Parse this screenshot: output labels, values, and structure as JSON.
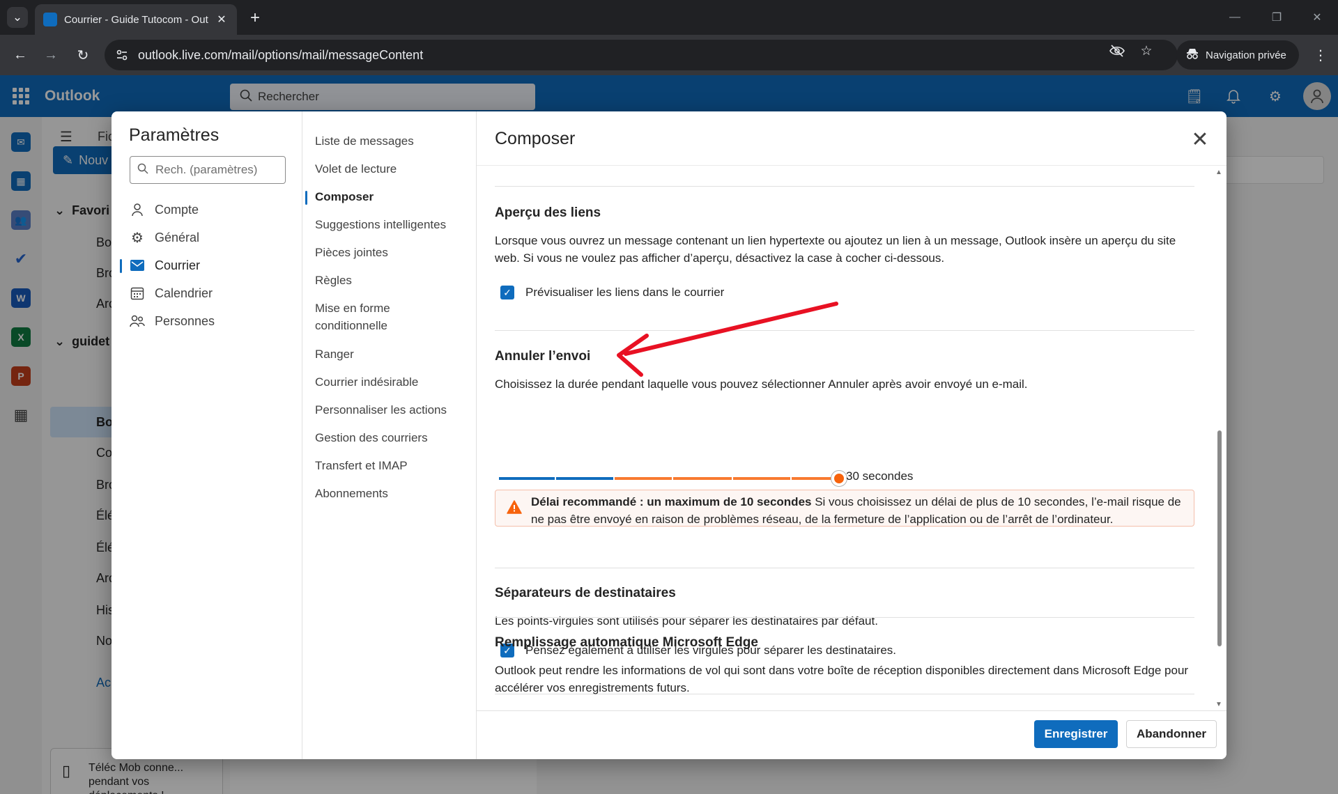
{
  "browser": {
    "tab_title": "Courrier - Guide Tutocom - Out",
    "url": "outlook.live.com/mail/options/mail/messageContent",
    "private_label": "Navigation privée"
  },
  "outlook": {
    "brand": "Outlook",
    "search_placeholder": "Rechercher",
    "new_mail_label": "Nouv",
    "folder_header_label": "Fic",
    "favorites_label": "Favori",
    "account_label": "guidet",
    "fav_items": [
      "Boi",
      "Bro",
      "Arc"
    ],
    "account_items": [
      "Boi",
      "Co",
      "Bro",
      "Élé",
      "Élé",
      "Arc",
      "His",
      "No"
    ],
    "groups_label": "Ac",
    "mobile_card_text": "Téléc Mob conne... pendant vos déplacements !"
  },
  "settings": {
    "title": "Paramètres",
    "search_placeholder": "Rech. (paramètres)",
    "categories": [
      {
        "label": "Compte",
        "icon": "person-icon"
      },
      {
        "label": "Général",
        "icon": "gear-icon"
      },
      {
        "label": "Courrier",
        "icon": "mail-icon",
        "active": true
      },
      {
        "label": "Calendrier",
        "icon": "calendar-icon"
      },
      {
        "label": "Personnes",
        "icon": "people-icon"
      }
    ],
    "subcategories": [
      "Liste de messages",
      "Volet de lecture",
      "Composer",
      "Suggestions intelligentes",
      "Pièces jointes",
      "Règles",
      "Mise en forme conditionnelle",
      "Ranger",
      "Courrier indésirable",
      "Personnaliser les actions",
      "Gestion des courriers",
      "Transfert et IMAP",
      "Abonnements"
    ],
    "active_subcategory": "Composer"
  },
  "pane": {
    "title": "Composer",
    "link_preview": {
      "heading": "Aperçu des liens",
      "description": "Lorsque vous ouvrez un message contenant un lien hypertexte ou ajoutez un lien à un message, Outlook insère un aperçu du site web. Si vous ne voulez pas afficher d’aperçu, désactivez la case à cocher ci-dessous.",
      "checkbox_label": "Prévisualiser les liens dans le courrier",
      "checked": true
    },
    "undo_send": {
      "heading": "Annuler l’envoi",
      "description": "Choisissez la durée pendant laquelle vous pouvez sélectionner Annuler après avoir envoyé un e-mail.",
      "slider_value_seconds": 30,
      "slider_max_seconds": 30,
      "slider_value_label": "30 secondes",
      "warning_bold": "Délai recommandé : un maximum de 10 secondes",
      "warning_text": " Si vous choisissez un délai de plus de 10 secondes, l’e-mail risque de ne pas être envoyé en raison de problèmes réseau, de la fermeture de l’application ou de l’arrêt de l’ordinateur."
    },
    "separators": {
      "heading": "Séparateurs de destinataires",
      "description": "Les points-virgules sont utilisés pour séparer les destinataires par défaut.",
      "checkbox_label": "Pensez également à utiliser les virgules pour séparer les destinataires.",
      "checked": true
    },
    "edge_autofill": {
      "heading": "Remplissage automatique Microsoft Edge",
      "description": "Outlook peut rendre les informations de vol qui sont dans votre boîte de réception disponibles directement dans Microsoft Edge pour accélérer vos enregistrements futurs."
    },
    "save_label": "Enregistrer",
    "discard_label": "Abandonner"
  },
  "colors": {
    "accent": "#0f6cbd",
    "slider_warning": "#f7630c",
    "annotation_arrow": "#e81123"
  }
}
